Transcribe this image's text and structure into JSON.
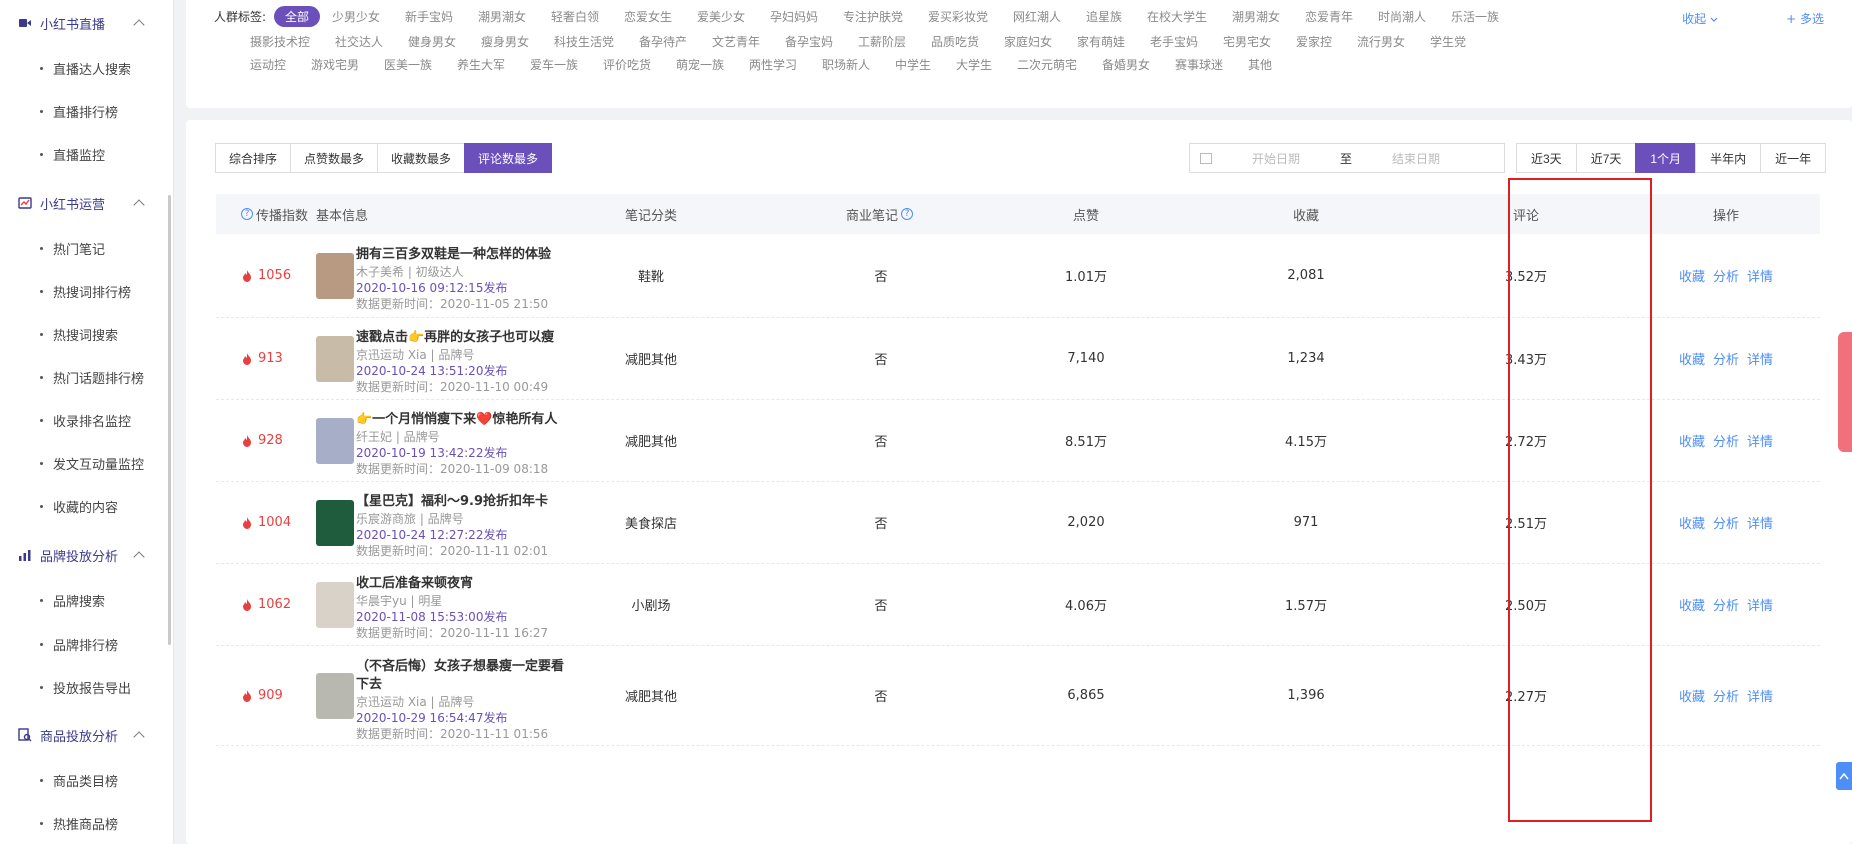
{
  "sidebar": {
    "groups": [
      {
        "label": "小红书直播",
        "items": [
          "直播达人搜索",
          "直播排行榜",
          "直播监控"
        ]
      },
      {
        "label": "小红书运营",
        "items": [
          "热门笔记",
          "热搜词排行榜",
          "热搜词搜索",
          "热门话题排行榜",
          "收录排名监控",
          "发文互动量监控",
          "收藏的内容"
        ]
      },
      {
        "label": "品牌投放分析",
        "items": [
          "品牌搜索",
          "品牌排行榜",
          "投放报告导出"
        ]
      },
      {
        "label": "商品投放分析",
        "items": [
          "商品类目榜",
          "热推商品榜"
        ]
      }
    ]
  },
  "tags": {
    "label": "人群标签:",
    "row1": [
      "全部",
      "少男少女",
      "新手宝妈",
      "潮男潮女",
      "轻奢白领",
      "恋爱女生",
      "爱美少女",
      "孕妇妈妈",
      "专注护肤党",
      "爱买彩妆党",
      "网红潮人",
      "追星族",
      "在校大学生",
      "潮男潮女",
      "恋爱青年",
      "时尚潮人",
      "乐活一族"
    ],
    "row2": [
      "摄影技术控",
      "社交达人",
      "健身男女",
      "瘦身男女",
      "科技生活党",
      "备孕待产",
      "文艺青年",
      "备孕宝妈",
      "工薪阶层",
      "品质吃货",
      "家庭妇女",
      "家有萌娃",
      "老手宝妈",
      "宅男宅女",
      "爱家控",
      "流行男女",
      "学生党"
    ],
    "row3": [
      "运动控",
      "游戏宅男",
      "医美一族",
      "养生大军",
      "爱车一族",
      "评价吃货",
      "萌宠一族",
      "两性学习",
      "职场新人",
      "中学生",
      "大学生",
      "二次元萌宅",
      "备婚男女",
      "赛事球迷",
      "其他"
    ],
    "collapse": "收起",
    "multi": "+ 多选"
  },
  "sort_tabs": [
    "综合排序",
    "点赞数最多",
    "收藏数最多",
    "评论数最多"
  ],
  "date_range": {
    "start_placeholder": "开始日期",
    "separator": "至",
    "end_placeholder": "结束日期"
  },
  "periods": [
    "近3天",
    "近7天",
    "1个月",
    "半年内",
    "近一年"
  ],
  "table": {
    "headers": {
      "spread": "传播指数",
      "info": "基本信息",
      "category": "笔记分类",
      "commercial": "商业笔记",
      "likes": "点赞",
      "favorites": "收藏",
      "comments": "评论",
      "ops": "操作"
    },
    "rows": [
      {
        "heat": "1056",
        "title": "拥有三百多双鞋是一种怎样的体验",
        "title2": "",
        "author": "木子美希 | 初级达人",
        "pub": "2020-10-16 09:12:15发布",
        "upd": "数据更新时间：2020-11-05 21:50",
        "category": "鞋靴",
        "commercial": "否",
        "likes": "1.01万",
        "favorites": "2,081",
        "comments": "3.52万",
        "thumb_color": "#b89a82"
      },
      {
        "heat": "913",
        "title": "速戳点击👉再胖的女孩子也可以瘦",
        "title2": "",
        "author": "京迅运动 Xia | 品牌号",
        "pub": "2020-10-24 13:51:20发布",
        "upd": "数据更新时间：2020-11-10 00:49",
        "category": "减肥其他",
        "commercial": "否",
        "likes": "7,140",
        "favorites": "1,234",
        "comments": "3.43万",
        "thumb_color": "#c8bca8"
      },
      {
        "heat": "928",
        "title": "👉一个月悄悄瘦下来❤️惊艳所有人",
        "title2": "",
        "author": "纤王妃 | 品牌号",
        "pub": "2020-10-19 13:42:22发布",
        "upd": "数据更新时间：2020-11-09 08:18",
        "category": "减肥其他",
        "commercial": "否",
        "likes": "8.51万",
        "favorites": "4.15万",
        "comments": "2.72万",
        "thumb_color": "#a6aec8"
      },
      {
        "heat": "1004",
        "title": "【星巴克】福利～9.9抢折扣年卡",
        "title2": "",
        "author": "乐宸游商旅 | 品牌号",
        "pub": "2020-10-24 12:27:22发布",
        "upd": "数据更新时间：2020-11-11 02:01",
        "category": "美食探店",
        "commercial": "否",
        "likes": "2,020",
        "favorites": "971",
        "comments": "2.51万",
        "thumb_color": "#1f5c3e"
      },
      {
        "heat": "1062",
        "title": "收工后准备来顿夜宵",
        "title2": "",
        "author": "华晨宇yu | 明星",
        "pub": "2020-11-08 15:53:00发布",
        "upd": "数据更新时间：2020-11-11 16:27",
        "category": "小剧场",
        "commercial": "否",
        "likes": "4.06万",
        "favorites": "1.57万",
        "comments": "2.50万",
        "thumb_color": "#d9d2c8"
      },
      {
        "heat": "909",
        "title": "（不吝后悔）女孩子想暴瘦一定要看",
        "title2": "下去",
        "author": "京迅运动 Xia | 品牌号",
        "pub": "2020-10-29 16:54:47发布",
        "upd": "数据更新时间：2020-11-11 01:56",
        "category": "减肥其他",
        "commercial": "否",
        "likes": "6,865",
        "favorites": "1,396",
        "comments": "2.27万",
        "thumb_color": "#b8b8b0"
      }
    ],
    "ops": [
      "收藏",
      "分析",
      "详情"
    ]
  },
  "colors": {
    "accent": "#6b4fbb",
    "link": "#4e8ef7",
    "heat": "#e84040",
    "highlight": "#e02020"
  }
}
